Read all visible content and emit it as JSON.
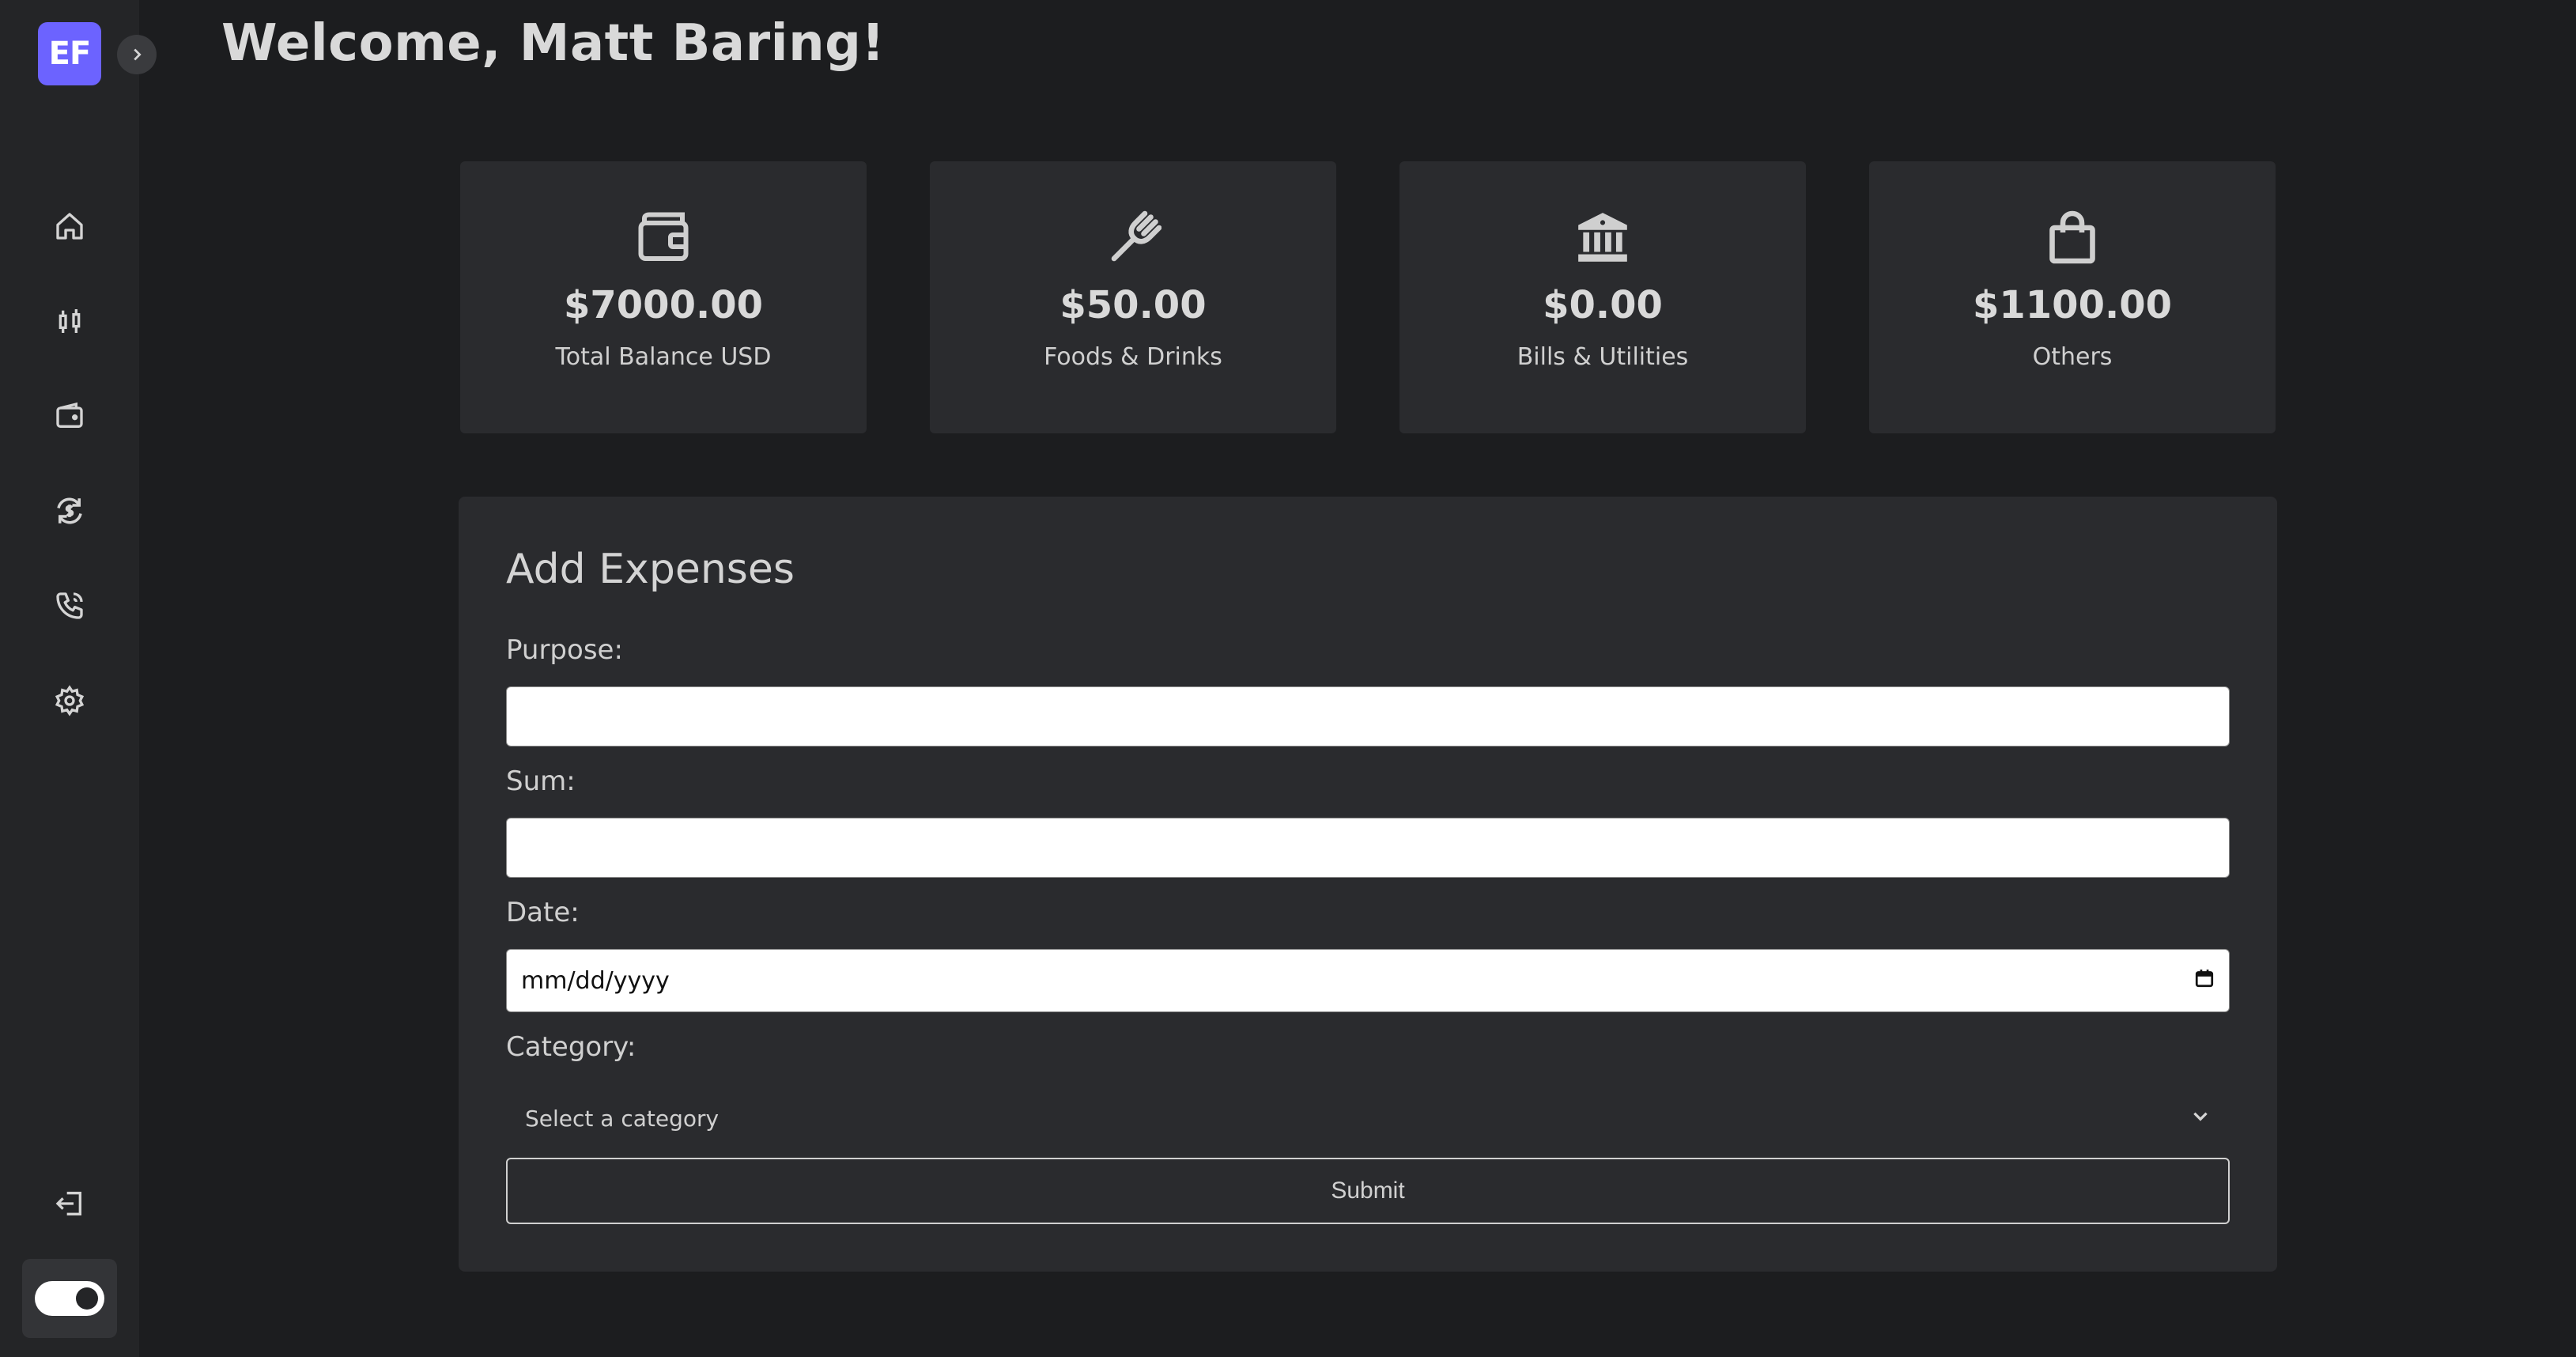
{
  "sidebar": {
    "logo_text": "EF",
    "nav_items": [
      {
        "icon": "home-icon"
      },
      {
        "icon": "candlestick-chart-icon"
      },
      {
        "icon": "wallet-icon"
      },
      {
        "icon": "currency-exchange-icon"
      },
      {
        "icon": "phone-icon"
      },
      {
        "icon": "settings-icon"
      }
    ],
    "logout_icon": "logout-icon",
    "theme_toggle": "dark-mode-toggle"
  },
  "header": {
    "welcome": "Welcome, Matt Baring!"
  },
  "summary_cards": [
    {
      "icon": "wallet-icon",
      "amount": "$7000.00",
      "label": "Total Balance USD"
    },
    {
      "icon": "fork-icon",
      "amount": "$50.00",
      "label": "Foods & Drinks"
    },
    {
      "icon": "bank-icon",
      "amount": "$0.00",
      "label": "Bills & Utilities"
    },
    {
      "icon": "shopping-bag-icon",
      "amount": "$1100.00",
      "label": "Others"
    }
  ],
  "form": {
    "title": "Add Expenses",
    "purpose_label": "Purpose:",
    "purpose_value": "",
    "sum_label": "Sum:",
    "sum_value": "",
    "date_label": "Date:",
    "date_placeholder": "mm/dd/yyyy",
    "category_label": "Category:",
    "category_selected": "Select a category",
    "submit_label": "Submit"
  },
  "colors": {
    "background": "#1c1d1f",
    "sidebar": "#242527",
    "card": "#2a2b2e",
    "accent": "#6c63ff"
  }
}
